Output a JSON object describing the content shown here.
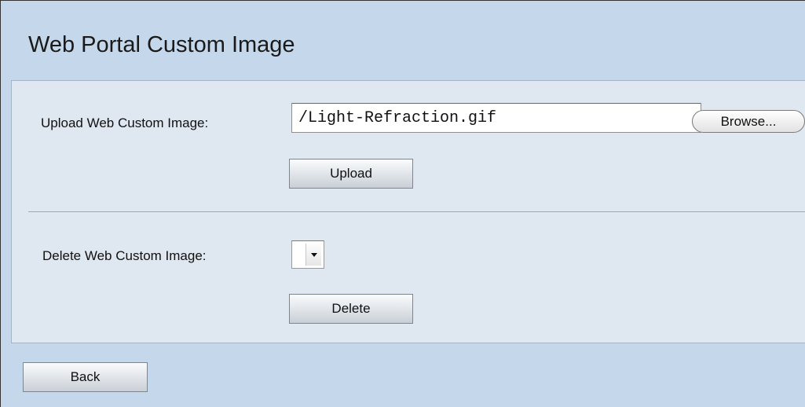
{
  "page": {
    "title": "Web Portal Custom Image"
  },
  "upload": {
    "label": "Upload Web Custom Image:",
    "file_value": "/Light-Refraction.gif",
    "browse_label": "Browse...",
    "upload_label": "Upload"
  },
  "delete": {
    "label": "Delete Web Custom Image:",
    "selected_value": "",
    "delete_label": "Delete"
  },
  "footer": {
    "back_label": "Back"
  },
  "colors": {
    "page_background": "#c5d7ea",
    "panel_background": "#dfe7f0"
  },
  "icons": {
    "select_dropdown": "chevron-down-icon"
  }
}
